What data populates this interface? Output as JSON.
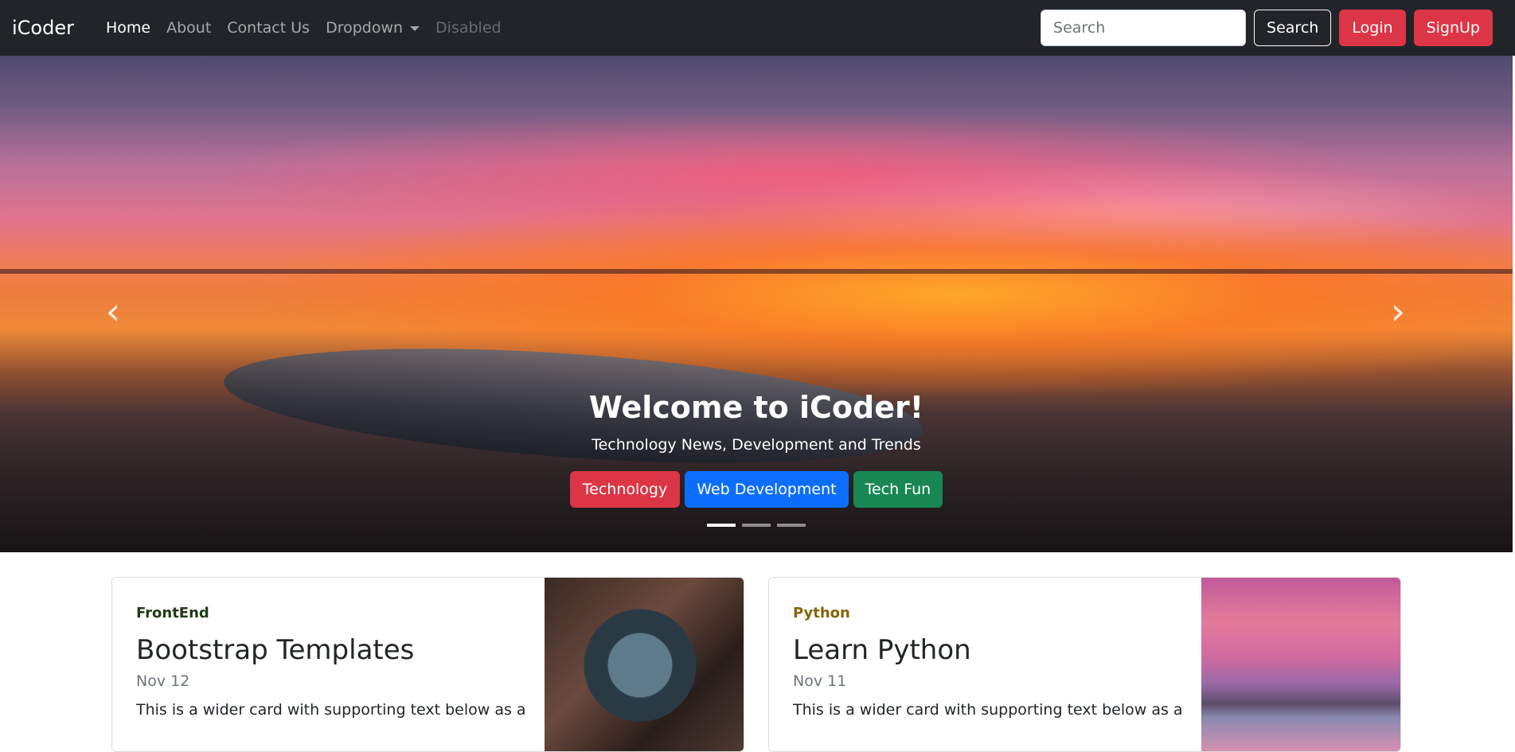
{
  "navbar": {
    "brand": "iCoder",
    "links": [
      {
        "label": "Home",
        "state": "active"
      },
      {
        "label": "About",
        "state": "normal"
      },
      {
        "label": "Contact Us",
        "state": "normal"
      },
      {
        "label": "Dropdown",
        "state": "normal"
      },
      {
        "label": "Disabled",
        "state": "disabled"
      }
    ],
    "search_placeholder": "Search",
    "search_button": "Search",
    "login_button": "Login",
    "signup_button": "SignUp"
  },
  "carousel": {
    "title": "Welcome to iCoder!",
    "subtitle": "Technology News, Development and Trends",
    "buttons": [
      "Technology",
      "Web Development",
      "Tech Fun"
    ],
    "prev_icon": "chevron-left-icon",
    "next_icon": "chevron-right-icon",
    "slides_total": 3,
    "active_slide": 1
  },
  "cards": [
    {
      "category": "FrontEnd",
      "title": "Bootstrap Templates",
      "date": "Nov 12",
      "text": "This is a wider card with supporting text below as a"
    },
    {
      "category": "Python",
      "title": "Learn Python",
      "date": "Nov 11",
      "text": "This is a wider card with supporting text below as a"
    }
  ],
  "colors": {
    "navbar_bg": "#212529",
    "danger": "#dc3545",
    "primary": "#0d6efd",
    "success": "#198754"
  }
}
